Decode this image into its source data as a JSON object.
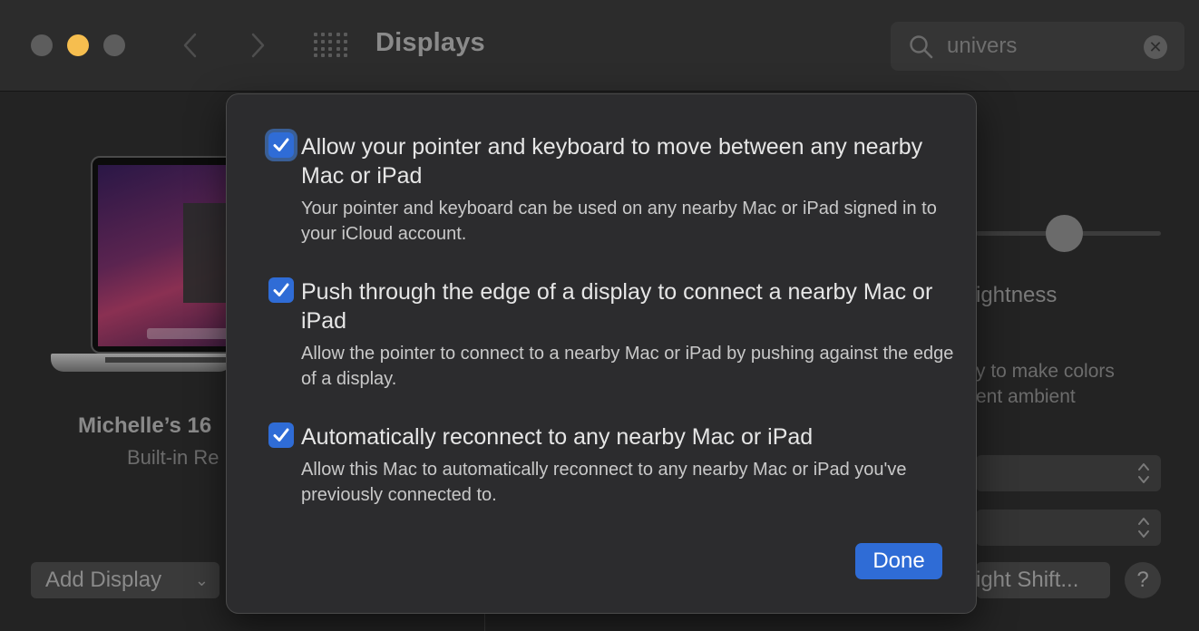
{
  "window": {
    "title": "Displays",
    "traffic_lights": {
      "close_color": "#5d5d5d",
      "minimize_color": "#f6be4f",
      "zoom_color": "#5d5d5d"
    },
    "nav": {
      "back_icon": "chevron-left-icon",
      "forward_icon": "chevron-right-icon",
      "grid_icon": "show-all-grid-icon"
    },
    "search": {
      "value": "univers",
      "icon": "search-icon",
      "clear_icon": "clear-circle-icon",
      "clear_glyph": "✕"
    }
  },
  "left_panel": {
    "device_name": "Michelle’s 16",
    "device_subtitle": "Built-in Re",
    "add_display_label": "Add Display",
    "add_display_chevron": "⌄"
  },
  "right_panel": {
    "brightness_label": "ightness",
    "ambient_line1": "y to make colors",
    "ambient_line2": "ent ambient",
    "night_shift_label": "ight Shift...",
    "help_label": "?"
  },
  "sheet": {
    "options": [
      {
        "title": "Allow your pointer and keyboard to move between any nearby Mac or iPad",
        "description": "Your pointer and keyboard can be used on any nearby Mac or iPad signed in to your iCloud account.",
        "checked": true
      },
      {
        "title": "Push through the edge of a display to connect a nearby Mac or iPad",
        "description": "Allow the pointer to connect to a nearby Mac or iPad by pushing against the edge of a display.",
        "checked": true
      },
      {
        "title": "Automatically reconnect to any nearby Mac or iPad",
        "description": "Allow this Mac to automatically reconnect to any nearby Mac or iPad you've previously connected to.",
        "checked": true
      }
    ],
    "done_label": "Done",
    "accent_color": "#2f6cd6"
  }
}
